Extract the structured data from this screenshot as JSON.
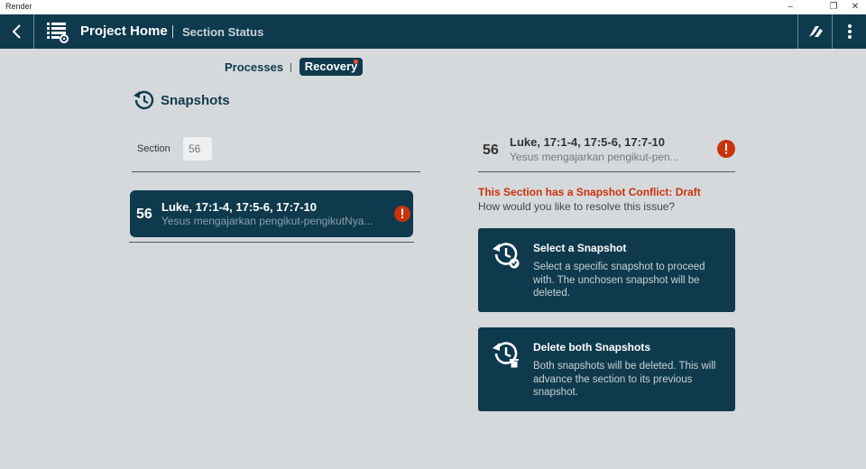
{
  "window": {
    "title": "Render"
  },
  "appbar": {
    "title": "Project Home",
    "subtitle": "Section Status"
  },
  "tabs": [
    {
      "label": "Processes"
    },
    {
      "label": "Recovery"
    }
  ],
  "snapshots": {
    "heading": "Snapshots"
  },
  "section_field": {
    "label": "Section",
    "value": "56"
  },
  "left_card": {
    "number": "56",
    "title": "Luke, 17:1-4, 17:5-6, 17:7-10",
    "subtitle": "Yesus mengajarkan pengikut-pengikutNya..."
  },
  "right_summary": {
    "number": "56",
    "title": "Luke, 17:1-4, 17:5-6, 17:7-10",
    "subtitle": "Yesus mengajarkan pengikut-pen..."
  },
  "conflict": {
    "message": "This Section has a Snapshot Conflict: Draft",
    "question": "How would you like to resolve this issue?"
  },
  "options": [
    {
      "title": "Select a Snapshot",
      "description": "Select a specific snapshot to proceed with. The unchosen snapshot will be deleted.",
      "icon": "history-check-icon"
    },
    {
      "title": "Delete both Snapshots",
      "description": "Both snapshots will be deleted. This will advance the section to its previous snapshot.",
      "icon": "history-trash-icon"
    }
  ],
  "colors": {
    "primary": "#0f3a4d",
    "background": "#d6d9dc",
    "warning": "#c8330b",
    "notification_dot": "#e0572c"
  }
}
